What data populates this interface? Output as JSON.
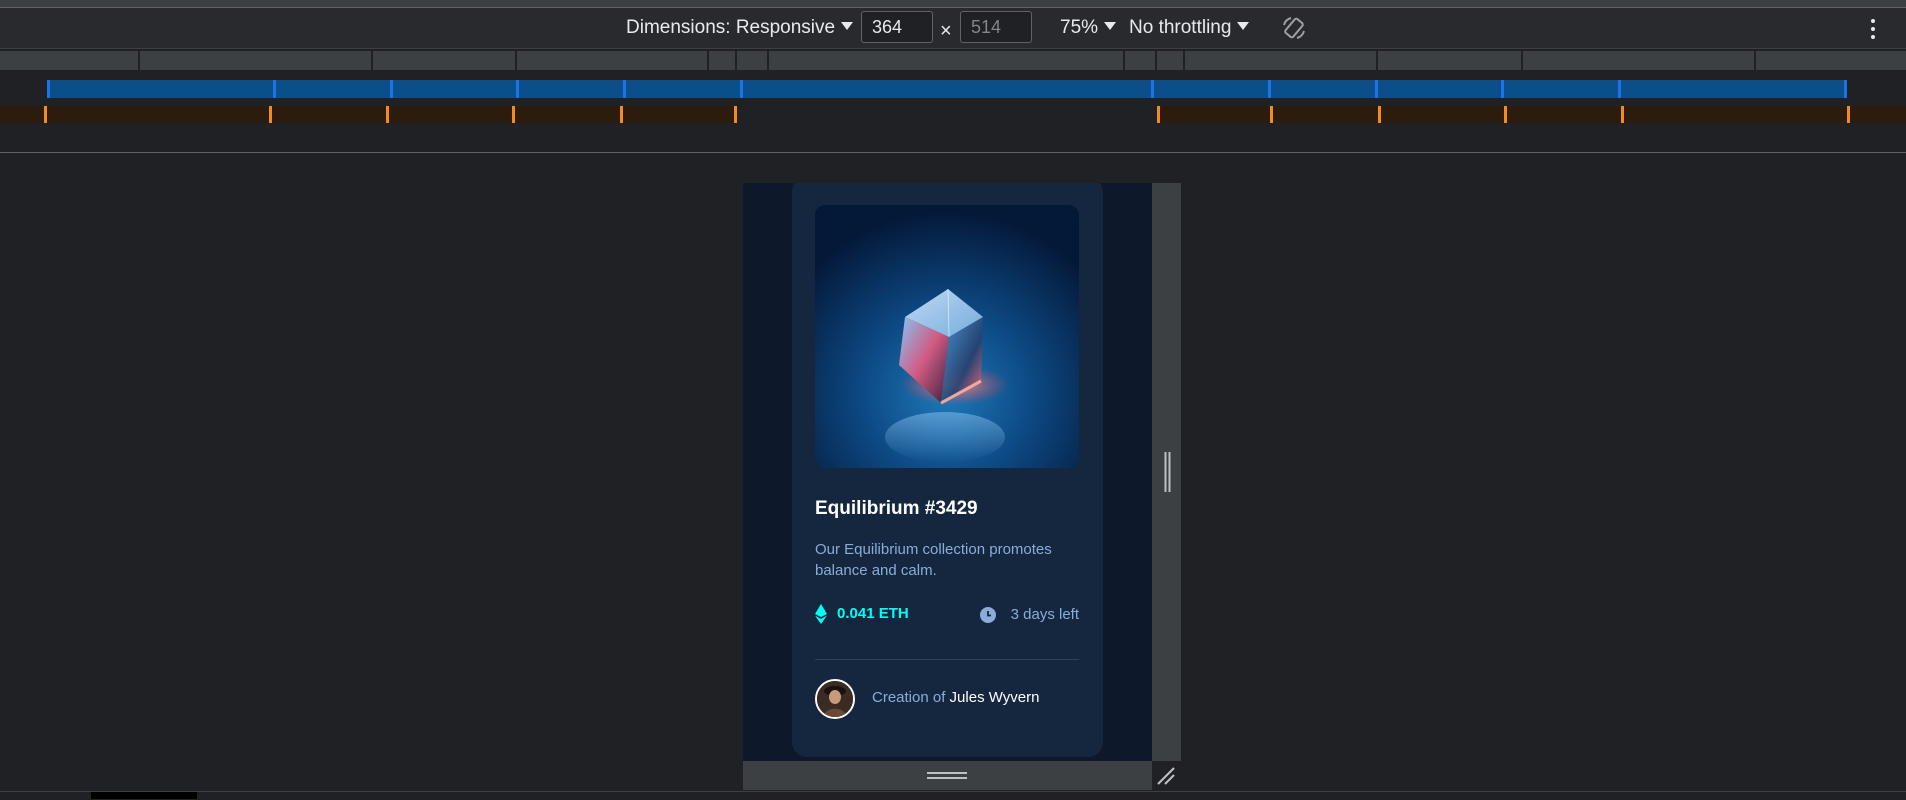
{
  "toolbar": {
    "dimensions_label": "Dimensions: Responsive",
    "width_value": "364",
    "height_placeholder": "514",
    "times": "×",
    "zoom": "75%",
    "throttling": "No throttling",
    "rotate_icon": "rotate-icon",
    "menu_icon": "kebab-icon"
  },
  "card": {
    "image_icon": "glass-cube",
    "title": "Equilibrium #3429",
    "description": "Our Equilibrium collection promotes balance and calm.",
    "price": "0.041 ETH",
    "time_left": "3 days left",
    "creator_prefix": "Creation of",
    "creator_name": "Jules Wyvern"
  },
  "colors": {
    "card_bg": "#15263f",
    "page_bg": "#0d192b",
    "cyan": "#00fff8",
    "soft_blue": "#8bacd9",
    "devtools_bg": "#202124",
    "mq_blue": "#1a73e8",
    "mq_orange": "#f28b22"
  }
}
